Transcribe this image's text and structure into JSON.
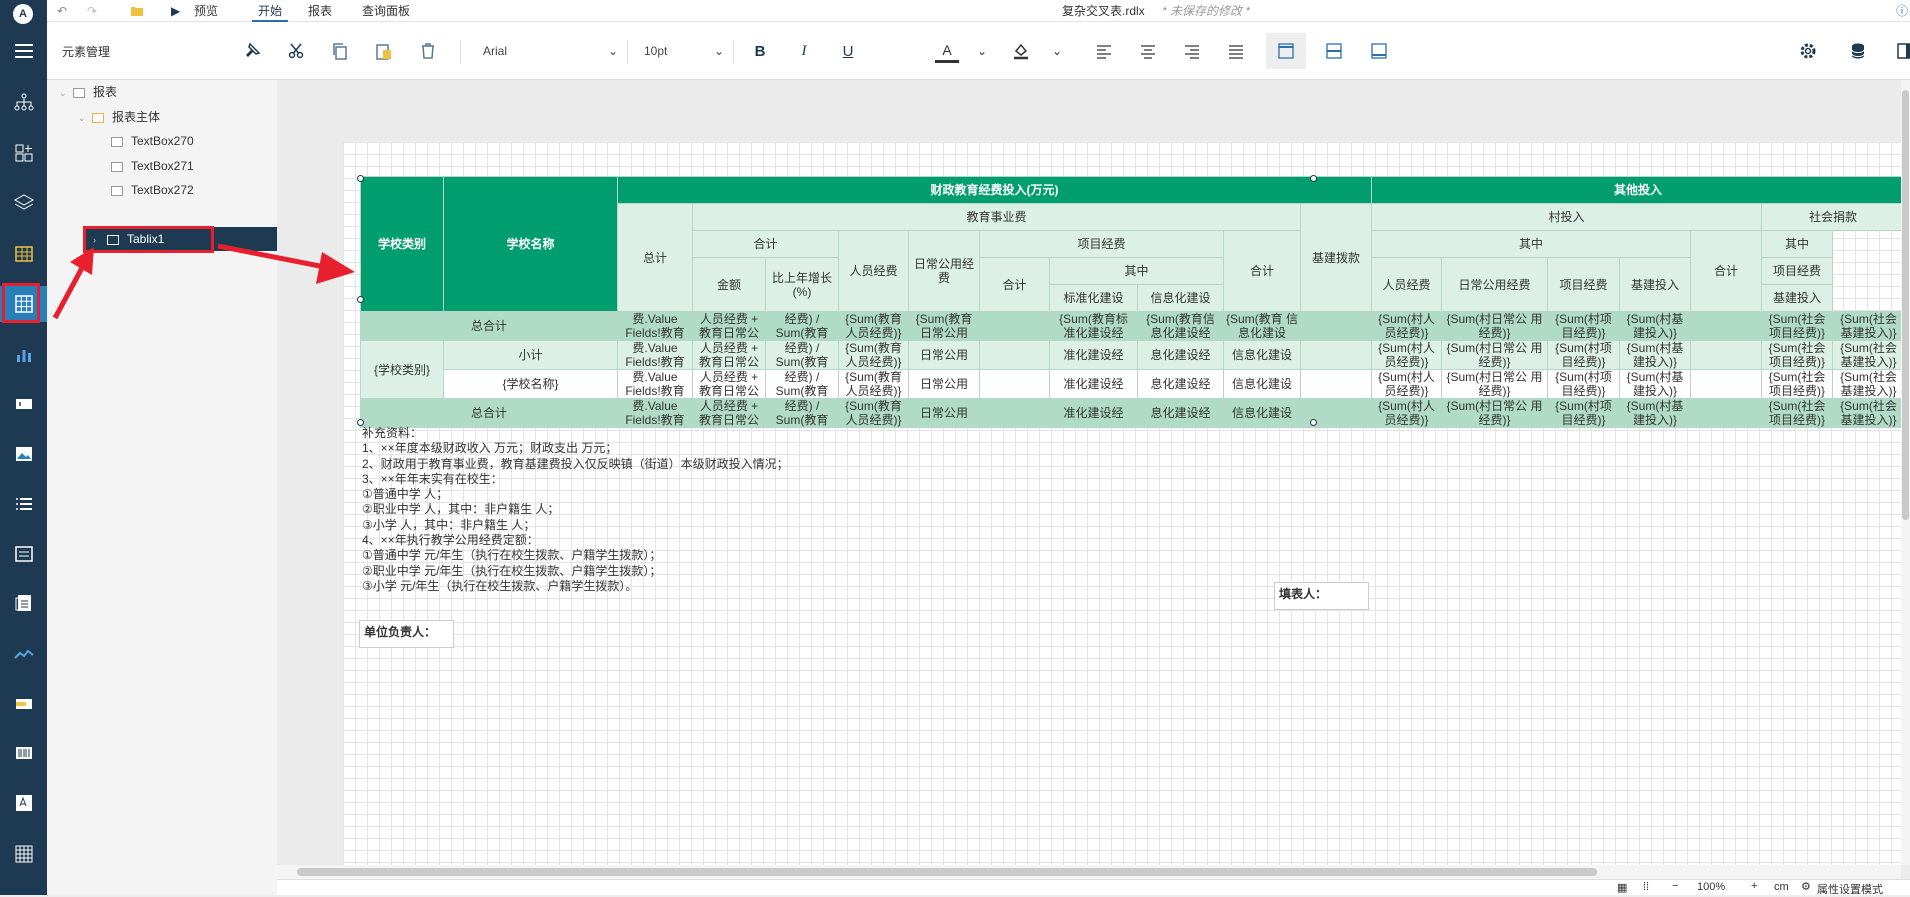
{
  "app": {
    "file_name": "复杂交叉表.rdlx",
    "unsaved_hint": "* 未保存的修改 *",
    "logo": "A"
  },
  "menu": {
    "preview": "预览",
    "tabs": [
      "开始",
      "报表",
      "查询面板"
    ]
  },
  "toolbar": {
    "panel_title": "元素管理",
    "font_family": "Arial",
    "font_size": "10pt",
    "bold": "B",
    "italic": "I",
    "underline": "U",
    "font_color_glyph": "A"
  },
  "tree": {
    "nodes": [
      "报表",
      "报表主体",
      "TextBox270",
      "TextBox271",
      "TextBox272",
      "Tablix1"
    ]
  },
  "table": {
    "h1": [
      "学校类别",
      "学校名称",
      "财政教育经费投入(万元)",
      "其他投入"
    ],
    "h2": [
      "总计",
      "教育事业费",
      "基建拨款",
      "村投入",
      "社会捐款"
    ],
    "h3": [
      "合计",
      "项目经费",
      "合计",
      "其中",
      "合计",
      "其中"
    ],
    "h4": [
      "金额",
      "比上年增长(%)",
      "人员经费",
      "日常公用经费",
      "合计",
      "其中"
    ],
    "h5": [
      "标准化建设",
      "信息化建设",
      "人员经费",
      "日常公用经费",
      "项目经费",
      "基建投入",
      "项目经费",
      "基建投入"
    ],
    "total_label": "总合计",
    "subtotal_label": "小计",
    "group_field": "{学校类别}",
    "name_field": "{学校名称}",
    "cells": {
      "zongji": "费.Value Fields!教育",
      "jine": "人员经费 + 教育日常公",
      "zengzhang": "经费) / Sum(教育",
      "renyuan": "{Sum(教育人员经费)}",
      "richang_top": "{Sum(教育 日常公用",
      "richang": "日常公用",
      "biaozhun": "{Sum(教育标 准化建设经",
      "biaozhun2": "准化建设经",
      "xinxi": "{Sum(教育信 息化建设经",
      "xinxi2": "息化建设经",
      "jijian": "{Sum(教育 信息化建设",
      "jijian2": "信息化建设",
      "cun_renyuan": "{Sum(村人 员经费)}",
      "cun_richang": "{Sum(村日常公 用经费)}",
      "cun_xiangmu": "{Sum(村项 目经费)}",
      "cun_jijian": "{Sum(村基 建投入)}",
      "she_xiangmu": "{Sum(社会 项目经费)}",
      "she_jijian": "{Sum(社会 基建投入)}"
    }
  },
  "notes": [
    "补充资料：",
    "1、××年度本级财政收入 万元；财政支出 万元；",
    "2、财政用于教育事业费，教育基建费投入仅反映镇（街道）本级财政投入情况；",
    "3、××年年末实有在校生：",
    "①普通中学 人；",
    "②职业中学 人，其中：非户籍生 人；",
    "③小学 人，其中：非户籍生 人；",
    "4、××年执行教学公用经费定额：",
    "①普通中学 元/年生（执行在校生拨款、户籍学生拨款）；",
    "②职业中学 元/年生（执行在校生拨款、户籍学生拨款）；",
    "③小学 元/年生（执行在校生拨款、户籍学生拨款）。"
  ],
  "labels": {
    "filler": "填表人：",
    "unit_head": "单位负责人："
  },
  "status": {
    "zoom": "100%",
    "unit": "cm",
    "property_mode": "属性设置模式"
  },
  "colors": {
    "sidebar": "#1e3a52",
    "accent": "#2980b9",
    "table_header": "#009e6e",
    "light_row": "#dcf0e6",
    "total_row": "#b0dcc7",
    "highlight": "#e8202e"
  }
}
